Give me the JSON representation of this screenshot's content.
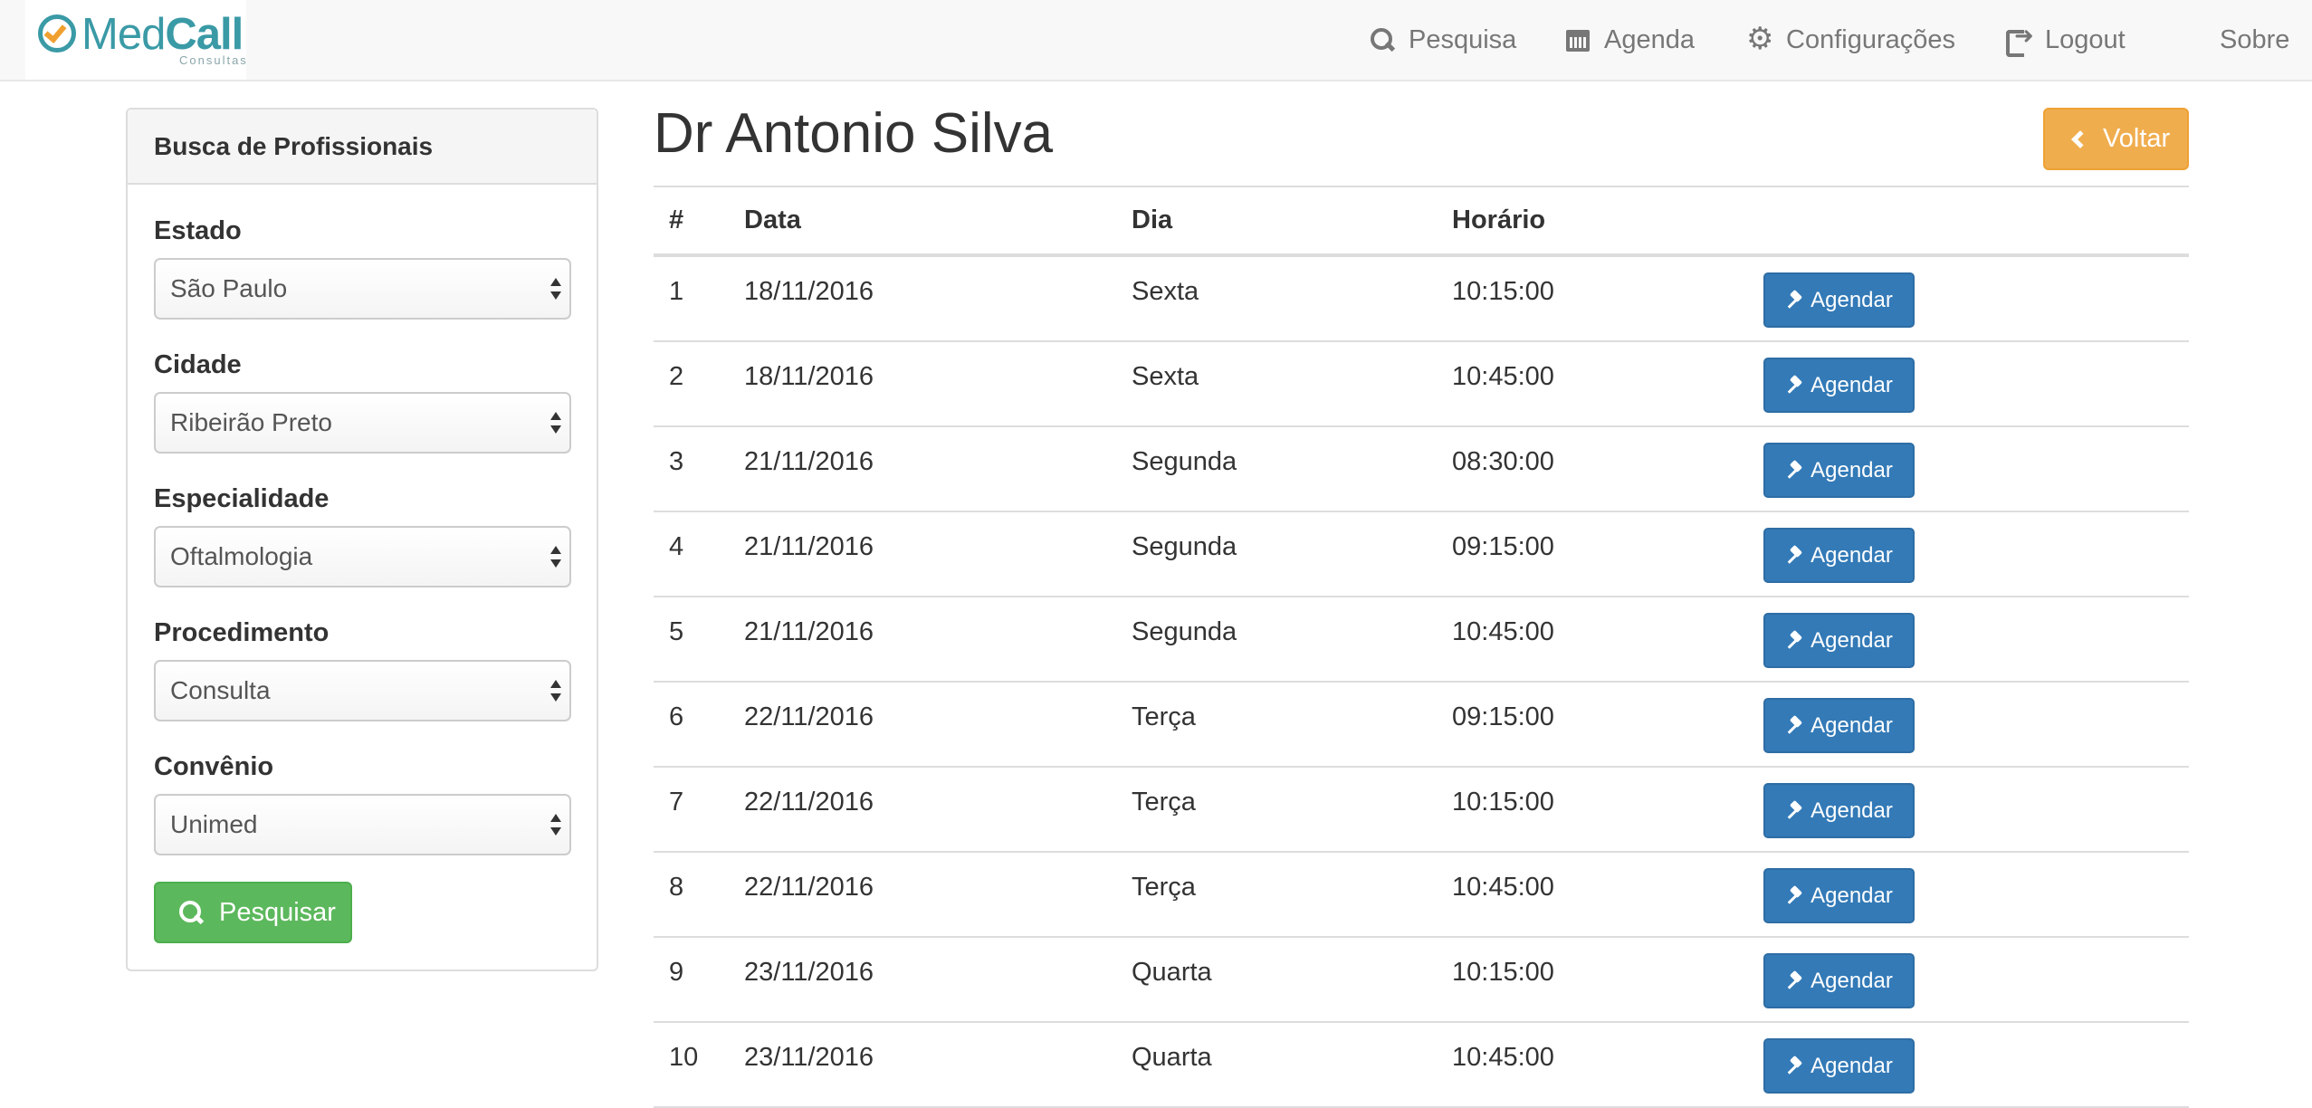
{
  "brand": {
    "name_part1": "Med",
    "name_part2": "Call",
    "subtitle": "Consultas"
  },
  "nav": {
    "items": [
      {
        "label": "Pesquisa",
        "icon": "search-icon"
      },
      {
        "label": "Agenda",
        "icon": "calendar-icon"
      },
      {
        "label": "Configurações",
        "icon": "gear-icon"
      },
      {
        "label": "Logout",
        "icon": "logout-icon"
      },
      {
        "label": "Sobre",
        "icon": "info-icon"
      }
    ]
  },
  "sidebar": {
    "heading": "Busca de Profissionais",
    "fields": [
      {
        "label": "Estado",
        "value": "São Paulo"
      },
      {
        "label": "Cidade",
        "value": "Ribeirão Preto"
      },
      {
        "label": "Especialidade",
        "value": "Oftalmologia"
      },
      {
        "label": "Procedimento",
        "value": "Consulta"
      },
      {
        "label": "Convênio",
        "value": "Unimed"
      }
    ],
    "search_button": "Pesquisar"
  },
  "main": {
    "title": "Dr Antonio Silva",
    "back_button": "Voltar",
    "columns": [
      "#",
      "Data",
      "Dia",
      "Horário"
    ],
    "action_label": "Agendar",
    "rows": [
      {
        "num": "1",
        "data": "18/11/2016",
        "dia": "Sexta",
        "horario": "10:15:00"
      },
      {
        "num": "2",
        "data": "18/11/2016",
        "dia": "Sexta",
        "horario": "10:45:00"
      },
      {
        "num": "3",
        "data": "21/11/2016",
        "dia": "Segunda",
        "horario": "08:30:00"
      },
      {
        "num": "4",
        "data": "21/11/2016",
        "dia": "Segunda",
        "horario": "09:15:00"
      },
      {
        "num": "5",
        "data": "21/11/2016",
        "dia": "Segunda",
        "horario": "10:45:00"
      },
      {
        "num": "6",
        "data": "22/11/2016",
        "dia": "Terça",
        "horario": "09:15:00"
      },
      {
        "num": "7",
        "data": "22/11/2016",
        "dia": "Terça",
        "horario": "10:15:00"
      },
      {
        "num": "8",
        "data": "22/11/2016",
        "dia": "Terça",
        "horario": "10:45:00"
      },
      {
        "num": "9",
        "data": "23/11/2016",
        "dia": "Quarta",
        "horario": "10:15:00"
      },
      {
        "num": "10",
        "data": "23/11/2016",
        "dia": "Quarta",
        "horario": "10:45:00"
      }
    ]
  },
  "colors": {
    "primary": "#337ab7",
    "success": "#5cb85c",
    "warning": "#f0ad4e",
    "brand_teal": "#3a9aa6",
    "brand_orange": "#f0a030"
  }
}
